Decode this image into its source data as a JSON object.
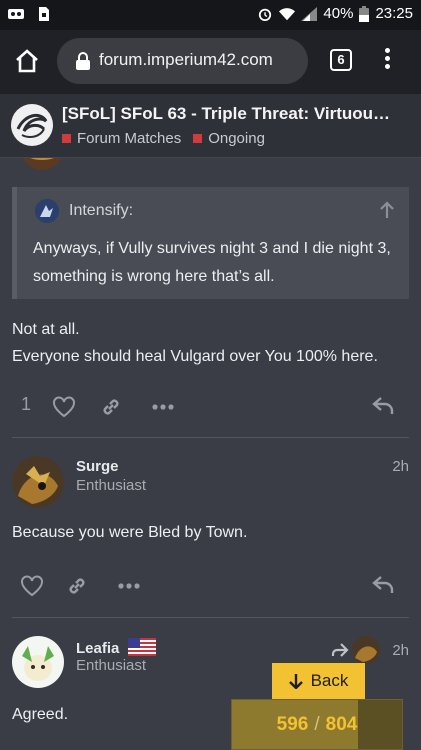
{
  "statusbar": {
    "battery": "40%",
    "time": "23:25"
  },
  "browser": {
    "url": "forum.imperium42.com",
    "tab_count": "6"
  },
  "topic": {
    "title": "[SFoL] SFoL 63 - Triple Threat: Virtuou…",
    "categories": [
      "Forum Matches",
      "Ongoing"
    ],
    "category_color": "#d13b3b"
  },
  "post1": {
    "quote_author": "Intensify:",
    "quote_text": "Anyways, if Vully survives night 3 and I die night 3, something is wrong here that’s all.",
    "text_lines": [
      "Not at all.",
      "Everyone should heal Vulgard over You 100% here."
    ],
    "like_count": "1"
  },
  "post2": {
    "username": "Surge",
    "user_title": "Enthusiast",
    "time": "2h",
    "text": "Because you were Bled by Town."
  },
  "post3": {
    "username": "Leafia",
    "user_title": "Enthusiast",
    "time": "2h",
    "text": "Agreed."
  },
  "timeline": {
    "back_label": "Back",
    "current": "596",
    "total": "804",
    "progress_fraction": 0.741
  },
  "colors": {
    "accent": "#f2c232",
    "background": "#3a3d46"
  }
}
